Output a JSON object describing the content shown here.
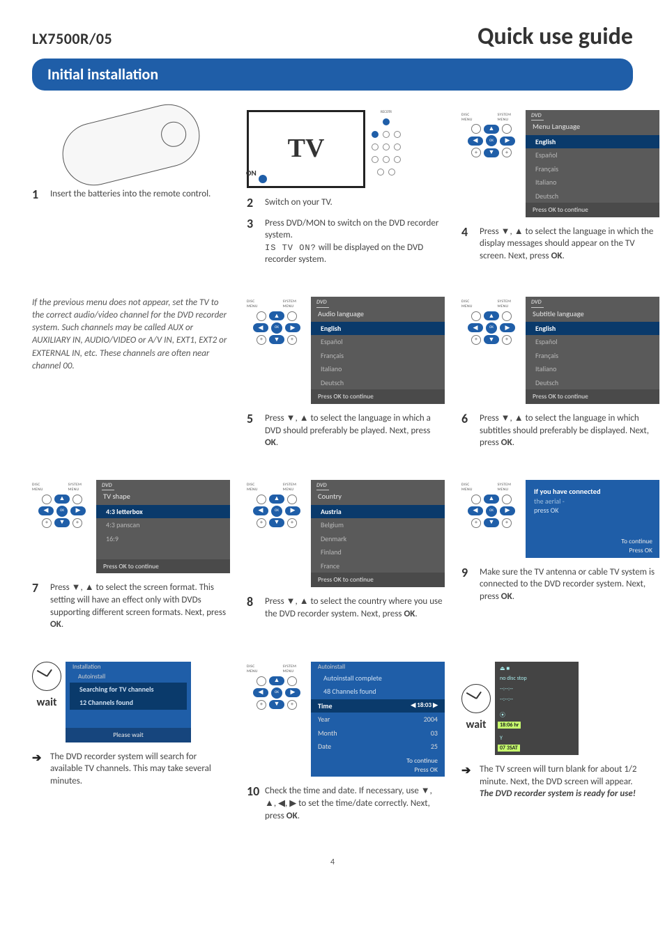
{
  "header": {
    "model": "LX7500R/05",
    "guide_title": "Quick use guide"
  },
  "section_title": "Initial installation",
  "tv_illus": {
    "on_label": "ON",
    "tv_label": "TV"
  },
  "wait_label": "wait",
  "dpad": {
    "disc_menu": "DISC MENU",
    "system_menu": "SYSTEM MENU",
    "ok": "OK"
  },
  "osd_common": {
    "dvd": "DVD",
    "press_ok": "Press OK to continue",
    "languages": [
      "English",
      "Español",
      "Français",
      "Italiano",
      "Deutsch"
    ]
  },
  "osd4": {
    "title": "Menu Language"
  },
  "osd5": {
    "title": "Audio language"
  },
  "osd6": {
    "title": "Subtitle language"
  },
  "osd7": {
    "title": "TV shape",
    "items": [
      "4:3 letterbox",
      "4:3 panscan",
      "16:9"
    ]
  },
  "osd8": {
    "title": "Country",
    "items": [
      "Austria",
      "Belgium",
      "Denmark",
      "Finland",
      "France"
    ]
  },
  "osd9": {
    "line1": "If you have connected",
    "line2": "the aerial -",
    "line3": "press OK",
    "foot": "To continue\nPress OK"
  },
  "osd_wait1": {
    "crumb1": "Installation",
    "crumb2": "Autoinstall",
    "line1": "Searching for TV channels",
    "line2": "12 Channels found",
    "foot": "Please wait"
  },
  "osd10": {
    "crumb": "Autoinstall",
    "headline1": "Autoinstall complete",
    "headline2": "48 Channels found",
    "rows": [
      {
        "label": "Time",
        "value": "18:03",
        "sel": true,
        "arrows": true
      },
      {
        "label": "Year",
        "value": "2004"
      },
      {
        "label": "Month",
        "value": "03"
      },
      {
        "label": "Date",
        "value": "25"
      }
    ],
    "foot": "To continue\nPress OK"
  },
  "device_display": {
    "top": "no disc  stop",
    "dashes": "--:--:--",
    "time": "18:06 hr",
    "channel": "07 3SAT"
  },
  "steps": {
    "s1": {
      "num": "1",
      "text": "Insert the batteries into the remote control."
    },
    "s2": {
      "num": "2",
      "text": "Switch on your TV."
    },
    "s3": {
      "num": "3",
      "text_a": "Press DVD/MON to switch on the DVD recorder system.",
      "mono": "IS TV ON?",
      "text_b": " will be displayed on the DVD recorder system."
    },
    "s4": {
      "num": "4",
      "text": "Press ▼, ▲ to select the language in which the display messages should appear on the TV screen. Next, press OK."
    },
    "note45": "If the previous menu does not appear, set the TV to the correct audio/video channel for the DVD recorder system. Such channels may be called AUX or AUXILIARY IN, AUDIO/VIDEO or A/V IN, EXT1, EXT2 or EXTERNAL IN, etc. These channels are often near channel 00.",
    "s5": {
      "num": "5",
      "text": "Press ▼, ▲ to select the language in which a DVD should preferably be played. Next, press OK."
    },
    "s6": {
      "num": "6",
      "text": "Press ▼, ▲ to select the language in which subtitles should preferably be displayed. Next, press OK."
    },
    "s7": {
      "num": "7",
      "text": "Press ▼, ▲ to select the screen format. This setting will have an effect only with DVDs supporting different screen formats. Next, press OK."
    },
    "s8": {
      "num": "8",
      "text": "Press ▼, ▲ to select the country where you use the DVD recorder system. Next, press OK."
    },
    "s9": {
      "num": "9",
      "text": "Make sure the TV antenna or cable TV system is connected to the DVD recorder system.  Next, press OK."
    },
    "sWait1": {
      "text": "The DVD recorder system will search for available TV channels. This may take several minutes."
    },
    "s10": {
      "num": "10",
      "text": "Check the time and date. If necessary, use ▼, ▲, ◀, ▶ to set the time/date correctly.  Next, press OK."
    },
    "sFinal": {
      "text": "The TV screen will turn blank for about 1/2 minute. Next, the DVD screen will appear.",
      "ready": "The DVD recorder system is ready for use!"
    }
  },
  "page_number": "4"
}
